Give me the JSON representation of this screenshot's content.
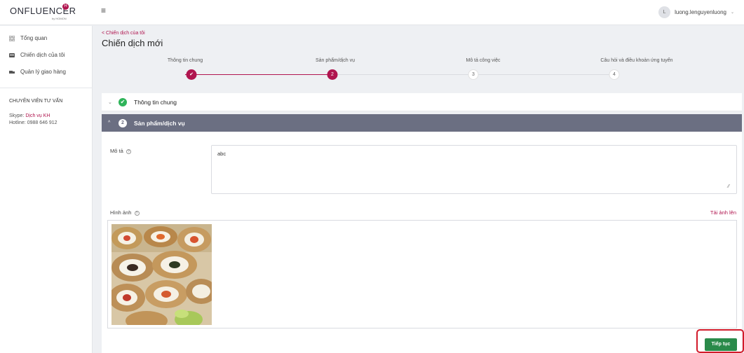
{
  "brand": {
    "name": "ONFLUENCER",
    "sub": "by HOMON",
    "badge": "H"
  },
  "header": {
    "user_initial": "L",
    "user_name": "luong.lenguyenluong"
  },
  "sidebar": {
    "items": [
      {
        "label": "Tổng quan",
        "icon": "grid-icon"
      },
      {
        "label": "Chiến dịch của tôi",
        "icon": "list-icon"
      },
      {
        "label": "Quản lý giao hàng",
        "icon": "truck-icon"
      }
    ],
    "advisor_title": "CHUYÊN VIÊN TƯ VẤN",
    "skype_label": "Skype:",
    "skype_value": "Dịch vụ KH",
    "hotline_label": "Hotline:",
    "hotline_value": "0988 646 912"
  },
  "breadcrumb": "< Chiến dịch của tôi",
  "page_title": "Chiến dịch mới",
  "stepper": {
    "steps": [
      {
        "label": "Thông tin chung",
        "marker": "✔",
        "state": "done"
      },
      {
        "label": "Sản phẩm/dịch vụ",
        "marker": "2",
        "state": "active"
      },
      {
        "label": "Mô tả công việc",
        "marker": "3",
        "state": "todo"
      },
      {
        "label": "Câu hỏi và điều khoản ứng tuyển",
        "marker": "4",
        "state": "todo"
      }
    ],
    "accent_color": "#b0154f"
  },
  "panels": {
    "general": {
      "title": "Thông tin chung",
      "chevron": "⌄",
      "check": "✔"
    },
    "product": {
      "number": "2",
      "title": "Sản phẩm/dịch vụ",
      "chevron": "^"
    }
  },
  "form": {
    "description_label": "Mô tả",
    "description_value": "abc",
    "image_label": "Hình ảnh",
    "upload_link": "Tải ảnh lên",
    "help_glyph": "?"
  },
  "actions": {
    "continue_label": "Tiếp tục",
    "button_color": "#2a8a4a"
  }
}
